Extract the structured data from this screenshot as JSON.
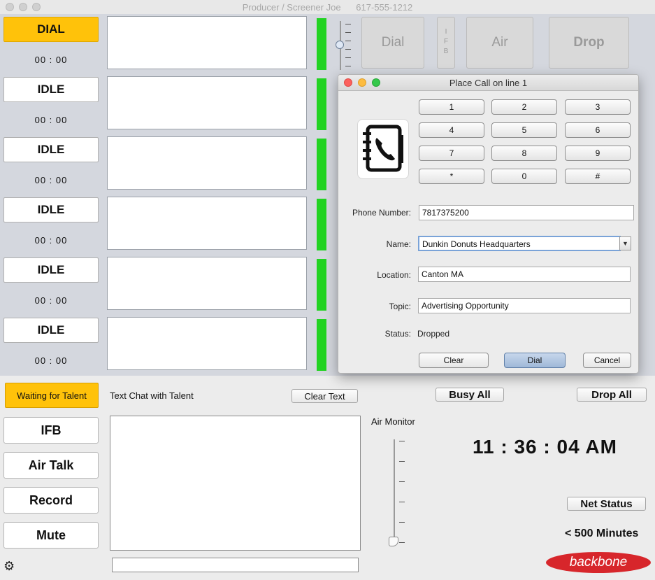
{
  "window": {
    "title": "Producer / Screener Joe      617-555-1212"
  },
  "lines": [
    {
      "state": "DIAL",
      "timer": "00 : 00"
    },
    {
      "state": "IDLE",
      "timer": "00 : 00"
    },
    {
      "state": "IDLE",
      "timer": "00 : 00"
    },
    {
      "state": "IDLE",
      "timer": "00 : 00"
    },
    {
      "state": "IDLE",
      "timer": "00 : 00"
    },
    {
      "state": "IDLE",
      "timer": "00 : 00"
    }
  ],
  "top_controls": {
    "dial": "Dial",
    "ifb": "I F B",
    "air": "Air",
    "drop": "Drop"
  },
  "dialog": {
    "title": "Place Call on line 1",
    "keypad": [
      "1",
      "2",
      "3",
      "4",
      "5",
      "6",
      "7",
      "8",
      "9",
      "*",
      "0",
      "#"
    ],
    "phone_label": "Phone Number:",
    "phone_value": "7817375200",
    "name_label": "Name:",
    "name_value": "Dunkin Donuts Headquarters",
    "location_label": "Location:",
    "location_value": "Canton MA",
    "topic_label": "Topic:",
    "topic_value": "Advertising Opportunity",
    "status_label": "Status:",
    "status_value": "Dropped",
    "clear": "Clear",
    "dial": "Dial",
    "cancel": "Cancel",
    "icon": "address-book-phone-icon"
  },
  "bottom": {
    "talent": "Waiting for Talent",
    "chat_label": "Text Chat with Talent",
    "clear_text": "Clear Text",
    "busy_all": "Busy All",
    "drop_all": "Drop All",
    "air_monitor": "Air Monitor",
    "buttons": [
      "IFB",
      "Air Talk",
      "Record",
      "Mute"
    ],
    "clock": "11 : 36 : 04 AM",
    "net_status": "Net Status",
    "minutes": "< 500 Minutes",
    "logo": "backbone",
    "settings_icon": "gear-icon"
  },
  "colors": {
    "accent": "#ffc20a",
    "meter": "#22d322",
    "logo": "#d7262b"
  }
}
